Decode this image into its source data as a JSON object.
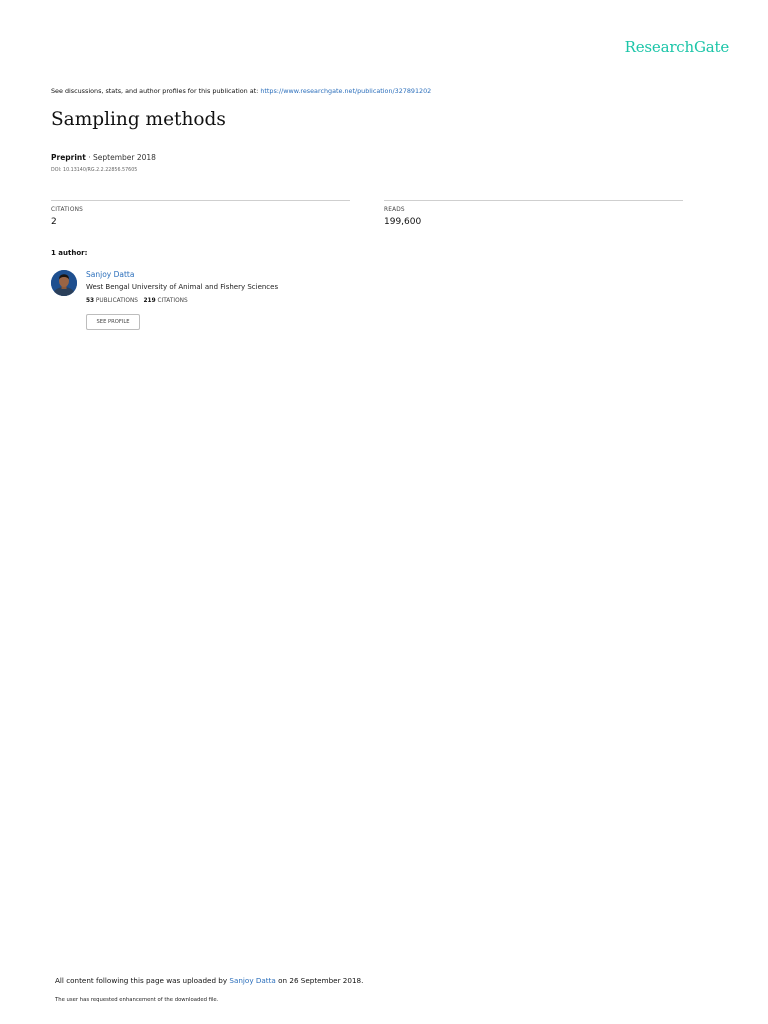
{
  "brand": {
    "name": "ResearchGate",
    "color": "#1bc5a8"
  },
  "header": {
    "discussion_text": "See discussions, stats, and author profiles for this publication at: ",
    "publication_url": "https://www.researchgate.net/publication/327891202"
  },
  "publication": {
    "title": "Sampling methods",
    "type": "Preprint",
    "separator": " · ",
    "date": "September 2018",
    "doi": "DOI: 10.13140/RG.2.2.22856.57605"
  },
  "stats": {
    "citations_label": "CITATIONS",
    "citations_value": "2",
    "reads_label": "READS",
    "reads_value": "199,600"
  },
  "authors": {
    "heading": "1 author:",
    "items": [
      {
        "name": "Sanjoy Datta",
        "affiliation": "West Bengal University of Animal and Fishery Sciences",
        "publications_count": "53",
        "publications_label": " PUBLICATIONS",
        "citations_count": "219",
        "citations_label": " CITATIONS",
        "profile_button": "SEE PROFILE"
      }
    ]
  },
  "footer": {
    "upload_prefix": "All content following this page was uploaded by ",
    "uploader": "Sanjoy Datta",
    "upload_suffix": " on 26 September 2018.",
    "enhancement_note": "The user has requested enhancement of the downloaded file."
  },
  "colors": {
    "link": "#2a6ebb",
    "rule": "#cfcfcf"
  }
}
